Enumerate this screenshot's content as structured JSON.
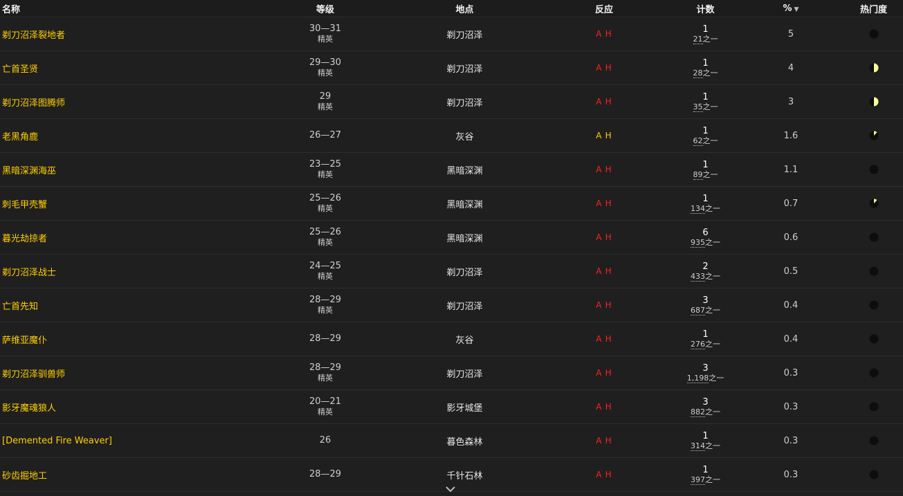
{
  "columns": {
    "name": "名称",
    "level": "等级",
    "location": "地点",
    "react": "反应",
    "count": "计数",
    "percent": "%",
    "popularity": "热门度"
  },
  "colors": {
    "name": "#ffd100",
    "hostile": "#ff2020",
    "neutral": "#ffd100",
    "pie_dark": "#0d0d0d",
    "pie_fill": "#ffff99"
  },
  "rows": [
    {
      "name": "剃刀沼泽裂地者",
      "level": "30—31",
      "rank": "精英",
      "zone": "剃刀沼泽",
      "react_a": "A",
      "react_h": "H",
      "react_color": "#ff2020",
      "count": "1",
      "of": "21",
      "of_suffix": "之一",
      "pct": "5",
      "pop": 0.0
    },
    {
      "name": "亡首圣贤",
      "level": "29—30",
      "rank": "精英",
      "zone": "剃刀沼泽",
      "react_a": "A",
      "react_h": "H",
      "react_color": "#ff2020",
      "count": "1",
      "of": "28",
      "of_suffix": "之一",
      "pct": "4",
      "pop": 0.5
    },
    {
      "name": "剃刀沼泽图腾师",
      "level": "29",
      "rank": "精英",
      "zone": "剃刀沼泽",
      "react_a": "A",
      "react_h": "H",
      "react_color": "#ff2020",
      "count": "1",
      "of": "35",
      "of_suffix": "之一",
      "pct": "3",
      "pop": 0.5
    },
    {
      "name": "老黑角鹿",
      "level": "26—27",
      "rank": "",
      "zone": "灰谷",
      "react_a": "A",
      "react_h": "H",
      "react_color": "#ffd100",
      "count": "1",
      "of": "62",
      "of_suffix": "之一",
      "pct": "1.6",
      "pop": 0.12
    },
    {
      "name": "黑暗深渊海巫",
      "level": "23—25",
      "rank": "精英",
      "zone": "黑暗深渊",
      "react_a": "A",
      "react_h": "H",
      "react_color": "#ff2020",
      "count": "1",
      "of": "89",
      "of_suffix": "之一",
      "pct": "1.1",
      "pop": 0.0
    },
    {
      "name": "刺毛甲壳蟹",
      "level": "25—26",
      "rank": "精英",
      "zone": "黑暗深渊",
      "react_a": "A",
      "react_h": "H",
      "react_color": "#ff2020",
      "count": "1",
      "of": "134",
      "of_suffix": "之一",
      "pct": "0.7",
      "pop": 0.12
    },
    {
      "name": "暮光劫掠者",
      "level": "25—26",
      "rank": "精英",
      "zone": "黑暗深渊",
      "react_a": "A",
      "react_h": "H",
      "react_color": "#ff2020",
      "count": "6",
      "of": "935",
      "of_suffix": "之一",
      "pct": "0.6",
      "pop": 0.0
    },
    {
      "name": "剃刀沼泽战士",
      "level": "24—25",
      "rank": "精英",
      "zone": "剃刀沼泽",
      "react_a": "A",
      "react_h": "H",
      "react_color": "#ff2020",
      "count": "2",
      "of": "433",
      "of_suffix": "之一",
      "pct": "0.5",
      "pop": 0.0
    },
    {
      "name": "亡首先知",
      "level": "28—29",
      "rank": "精英",
      "zone": "剃刀沼泽",
      "react_a": "A",
      "react_h": "H",
      "react_color": "#ff2020",
      "count": "3",
      "of": "687",
      "of_suffix": "之一",
      "pct": "0.4",
      "pop": 0.0
    },
    {
      "name": "萨维亚魔仆",
      "level": "28—29",
      "rank": "",
      "zone": "灰谷",
      "react_a": "A",
      "react_h": "H",
      "react_color": "#ff2020",
      "count": "1",
      "of": "276",
      "of_suffix": "之一",
      "pct": "0.4",
      "pop": 0.0
    },
    {
      "name": "剃刀沼泽驯兽师",
      "level": "28—29",
      "rank": "精英",
      "zone": "剃刀沼泽",
      "react_a": "A",
      "react_h": "H",
      "react_color": "#ff2020",
      "count": "3",
      "of": "1,198",
      "of_suffix": "之一",
      "pct": "0.3",
      "pop": 0.0
    },
    {
      "name": "影牙魔魂狼人",
      "level": "20—21",
      "rank": "精英",
      "zone": "影牙城堡",
      "react_a": "A",
      "react_h": "H",
      "react_color": "#ff2020",
      "count": "3",
      "of": "882",
      "of_suffix": "之一",
      "pct": "0.3",
      "pop": 0.0
    },
    {
      "name": "[Demented Fire Weaver]",
      "level": "26",
      "rank": "",
      "zone": "暮色森林",
      "react_a": "A",
      "react_h": "H",
      "react_color": "#ff2020",
      "count": "1",
      "of": "314",
      "of_suffix": "之一",
      "pct": "0.3",
      "pop": 0.0
    },
    {
      "name": "砂齿掘地工",
      "level": "28—29",
      "rank": "",
      "zone": "千针石林",
      "react_a": "A",
      "react_h": "H",
      "react_color": "#ff2020",
      "count": "1",
      "of": "397",
      "of_suffix": "之一",
      "pct": "0.3",
      "pop": 0.0
    }
  ]
}
